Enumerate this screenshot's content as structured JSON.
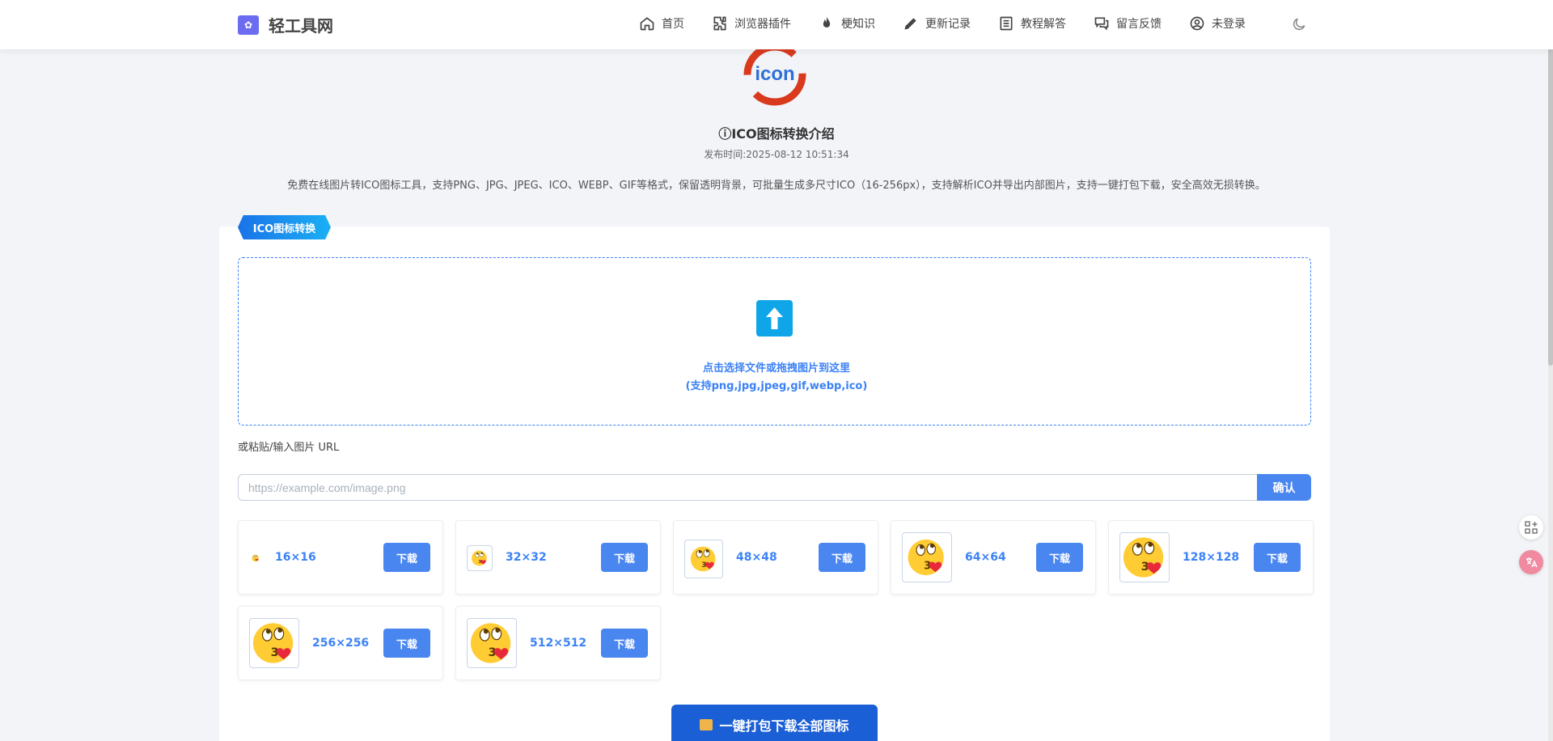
{
  "header": {
    "brand": "轻工具网",
    "nav": [
      {
        "label": "首页",
        "icon": "home-icon"
      },
      {
        "label": "浏览器插件",
        "icon": "puzzle-icon"
      },
      {
        "label": "梗知识",
        "icon": "fire-icon"
      },
      {
        "label": "更新记录",
        "icon": "pencil-icon"
      },
      {
        "label": "教程解答",
        "icon": "list-icon"
      },
      {
        "label": "留言反馈",
        "icon": "chat-icon"
      },
      {
        "label": "未登录",
        "icon": "user-icon"
      }
    ],
    "theme_icon": "moon-icon"
  },
  "intro": {
    "logo_text": "icon",
    "title": "ICO图标转换介绍",
    "title_icon": "ⓘ",
    "time": "发布时间:2025-08-12 10:51:34",
    "description": "免费在线图片转ICO图标工具，支持PNG、JPG、JPEG、ICO、WEBP、GIF等格式，保留透明背景，可批量生成多尺寸ICO（16-256px），支持解析ICO并导出内部图片，支持一键打包下载，安全高效无损转换。"
  },
  "converter": {
    "badge": "ICO图标转换",
    "dropzone": {
      "line1": "点击选择文件或拖拽图片到这里",
      "line2": "(支持png,jpg,jpeg,gif,webp,ico)"
    },
    "url_label": "或粘贴/输入图片 URL",
    "url_placeholder": "https://example.com/image.png",
    "confirm": "确认",
    "download_label": "下载",
    "sizes": [
      {
        "label": "16×16"
      },
      {
        "label": "32×32"
      },
      {
        "label": "48×48"
      },
      {
        "label": "64×64"
      },
      {
        "label": "128×128"
      },
      {
        "label": "256×256"
      },
      {
        "label": "512×512"
      }
    ],
    "download_all": "一键打包下载全部图标"
  },
  "colors": {
    "accent": "#4a86f0",
    "primary_dark": "#1a5fd6",
    "logo_red": "#d93a1e",
    "logo_blue": "#2f6fd6"
  }
}
